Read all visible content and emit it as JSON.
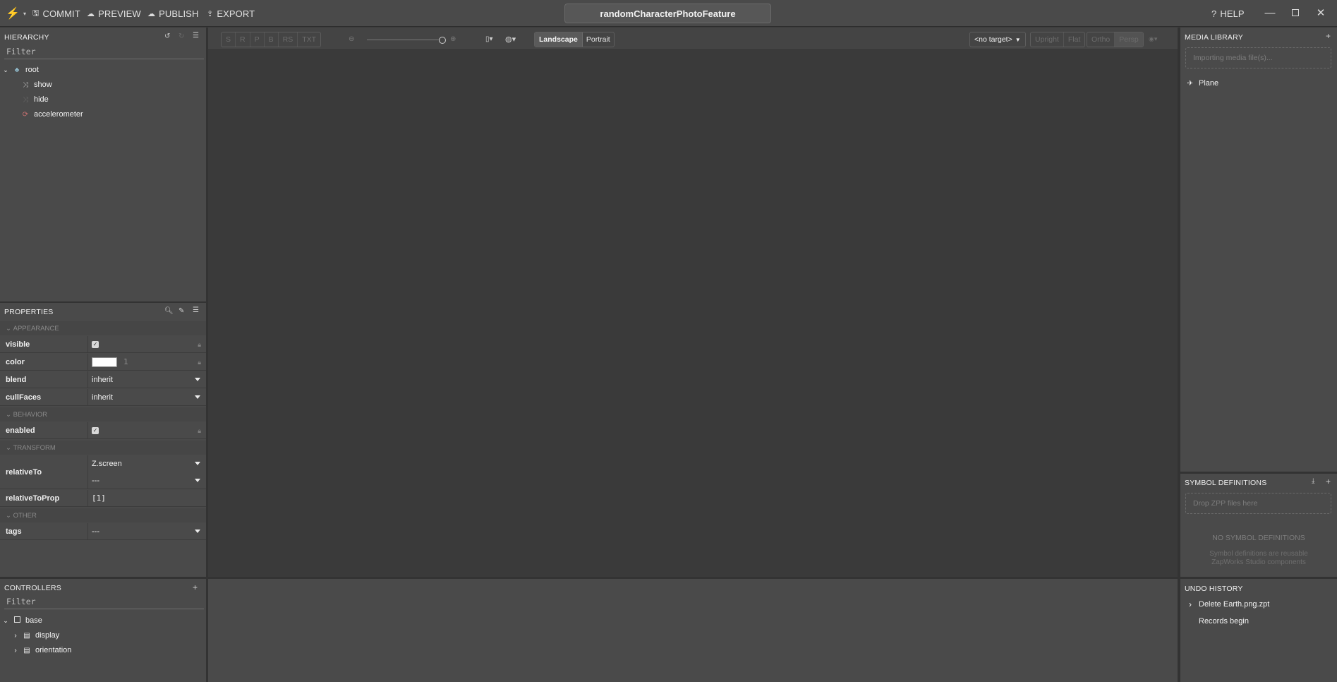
{
  "topbar": {
    "commit": "COMMIT",
    "preview": "PREVIEW",
    "publish": "PUBLISH",
    "export": "EXPORT",
    "project_title": "randomCharacterPhotoFeature",
    "help": "HELP"
  },
  "hierarchy": {
    "title": "HIERARCHY",
    "filter_placeholder": "Filter",
    "items": [
      {
        "label": "root",
        "icon": "tree-root-icon"
      },
      {
        "label": "show",
        "icon": "shuffle-icon"
      },
      {
        "label": "hide",
        "icon": "shuffle-icon"
      },
      {
        "label": "accelerometer",
        "icon": "sync-icon"
      }
    ]
  },
  "properties": {
    "title": "PROPERTIES",
    "sections": {
      "appearance": "APPEARANCE",
      "behavior": "BEHAVIOR",
      "transform": "TRANSFORM",
      "other": "OTHER"
    },
    "rows": {
      "visible": "visible",
      "color": "color",
      "color_alpha": "1",
      "blend": "blend",
      "blend_value": "inherit",
      "cullFaces": "cullFaces",
      "cullFaces_value": "inherit",
      "enabled": "enabled",
      "relativeTo": "relativeTo",
      "relativeTo_value1": "Z.screen",
      "relativeTo_value2": "---",
      "relativeToProp": "relativeToProp",
      "relativeToProp_value": "[1]",
      "tags": "tags",
      "tags_value": "---"
    },
    "color_swatch": "#ffffff"
  },
  "controllers": {
    "title": "CONTROLLERS",
    "filter_placeholder": "Filter",
    "items": [
      {
        "label": "base"
      },
      {
        "label": "display"
      },
      {
        "label": "orientation"
      }
    ]
  },
  "viewport": {
    "tools": [
      "S",
      "R",
      "P",
      "B",
      "RS",
      "TXT"
    ],
    "landscape": "Landscape",
    "portrait": "Portrait",
    "target": "<no target>",
    "upright": "Upright",
    "flat": "Flat",
    "ortho": "Ortho",
    "persp": "Persp"
  },
  "media_library": {
    "title": "MEDIA LIBRARY",
    "importing": "Importing media file(s)...",
    "items": [
      {
        "label": "Plane"
      }
    ]
  },
  "symbol_definitions": {
    "title": "SYMBOL DEFINITIONS",
    "drop_hint": "Drop ZPP files here",
    "empty_title": "NO SYMBOL DEFINITIONS",
    "empty_desc_1": "Symbol definitions are reusable",
    "empty_desc_2": "ZapWorks Studio components"
  },
  "undo_history": {
    "title": "UNDO HISTORY",
    "items": [
      {
        "label": "Delete Earth.png.zpt"
      },
      {
        "label": "Records begin"
      }
    ]
  },
  "colors": {
    "panel_bg": "#4a4a4a",
    "viewport_bg": "#3a3a3a",
    "accent_landscape": "#585858"
  }
}
